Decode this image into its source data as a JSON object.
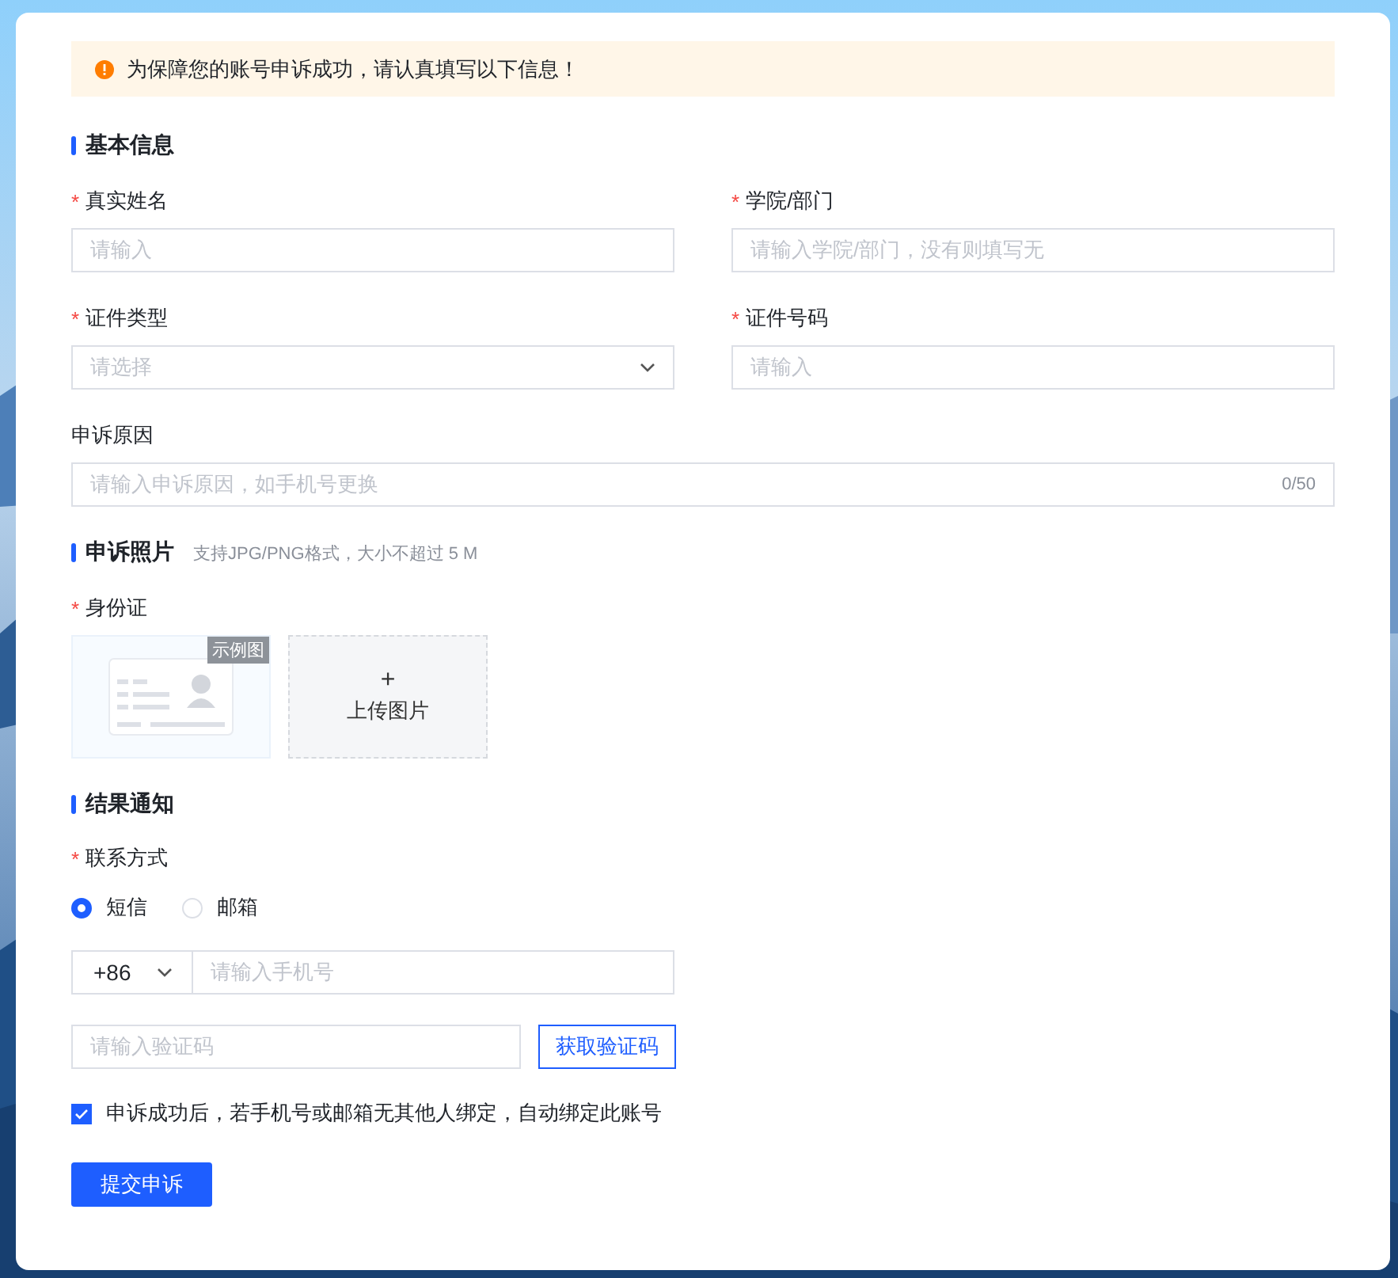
{
  "notice": {
    "text": "为保障您的账号申诉成功，请认真填写以下信息！"
  },
  "basic_info": {
    "title": "基本信息",
    "fields": [
      {
        "label": "真实姓名",
        "required_mark": "*",
        "kind": "input",
        "placeholder": "请输入",
        "wide": false
      },
      {
        "label": "学院/部门",
        "required_mark": "*",
        "kind": "input",
        "placeholder": "请输入学院/部门，没有则填写无",
        "wide": false
      },
      {
        "label": "证件类型",
        "required_mark": "*",
        "kind": "select",
        "placeholder": "请选择",
        "wide": false
      },
      {
        "label": "证件号码",
        "required_mark": "*",
        "kind": "input",
        "placeholder": "请输入",
        "wide": false
      },
      {
        "label": "申诉原因",
        "kind": "input",
        "placeholder": "请输入申诉原因，如手机号更换",
        "wide": true,
        "counter": "0/50"
      }
    ]
  },
  "photos": {
    "title": "申诉照片",
    "hint": "支持JPG/PNG格式，大小不超过 5 M",
    "label": "身份证",
    "required_mark": "*",
    "sample_badge": "示例图",
    "upload_symbol": "+",
    "upload_label": "上传图片"
  },
  "result": {
    "title": "结果通知",
    "label": "联系方式",
    "required_mark": "*",
    "methods": [
      {
        "label": "短信",
        "selected": true
      },
      {
        "label": "邮箱",
        "selected": false
      }
    ],
    "country_code": "+86",
    "phone_placeholder": "请输入手机号",
    "code_placeholder": "请输入验证码",
    "code_button": "获取验证码",
    "bind": {
      "label": "申诉成功后，若手机号或邮箱无其他人绑定，自动绑定此账号",
      "checked": true
    }
  },
  "submit": "提交申诉"
}
